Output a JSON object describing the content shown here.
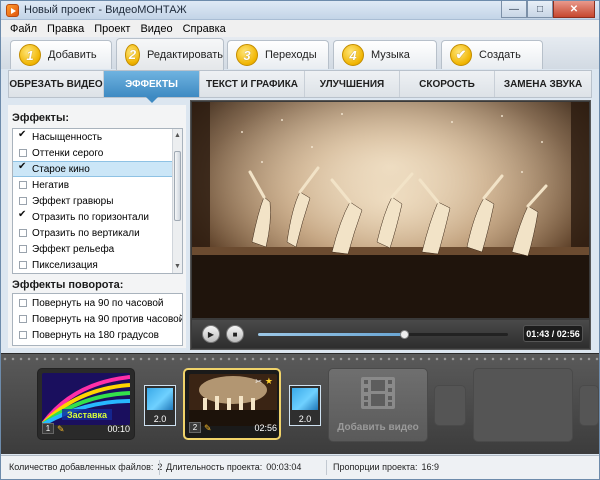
{
  "window": {
    "title": "Новый проект - ВидеоМОНТАЖ"
  },
  "menu": [
    "Файл",
    "Правка",
    "Проект",
    "Видео",
    "Справка"
  ],
  "steps": [
    {
      "num": "1",
      "label": "Добавить"
    },
    {
      "num": "2",
      "label": "Редактировать",
      "active": true
    },
    {
      "num": "3",
      "label": "Переходы"
    },
    {
      "num": "4",
      "label": "Музыка"
    },
    {
      "num": "check",
      "label": "Создать"
    }
  ],
  "tabs": [
    "ОБРЕЗАТЬ ВИДЕО",
    "ЭФФЕКТЫ",
    "ТЕКСТ И ГРАФИКА",
    "УЛУЧШЕНИЯ",
    "СКОРОСТЬ",
    "ЗАМЕНА ЗВУКА"
  ],
  "effects": {
    "title": "Эффекты:",
    "items": [
      {
        "label": "Насыщенность",
        "checked": true
      },
      {
        "label": "Оттенки серого",
        "checked": false
      },
      {
        "label": "Старое кино",
        "checked": true,
        "selected": true
      },
      {
        "label": "Негатив",
        "checked": false
      },
      {
        "label": "Эффект гравюры",
        "checked": false
      },
      {
        "label": "Отразить по горизонтали",
        "checked": true
      },
      {
        "label": "Отразить по вертикали",
        "checked": false
      },
      {
        "label": "Эффект рельефа",
        "checked": false
      },
      {
        "label": "Пикселизация",
        "checked": false
      }
    ]
  },
  "rotation": {
    "title": "Эффекты поворота:",
    "items": [
      {
        "label": "Повернуть на 90 по часовой",
        "checked": false
      },
      {
        "label": "Повернуть на 90 против часовой",
        "checked": false
      },
      {
        "label": "Повернуть на 180 градусов",
        "checked": false
      }
    ]
  },
  "player": {
    "time": "01:43 / 02:56",
    "progress": 0.585
  },
  "timeline": {
    "clips": [
      {
        "num": "1",
        "title": "Заставка",
        "duration": "00:10"
      },
      {
        "num": "2",
        "duration": "02:56",
        "selected": true
      }
    ],
    "transitions": [
      "2.0",
      "2.0"
    ],
    "add_video_label": "Добавить видео"
  },
  "status": {
    "files_label": "Количество добавленных файлов:",
    "files": "2",
    "duration_label": "Длительность проекта:",
    "duration": "00:03:04",
    "ratio_label": "Пропорции проекта:",
    "ratio": "16:9"
  }
}
